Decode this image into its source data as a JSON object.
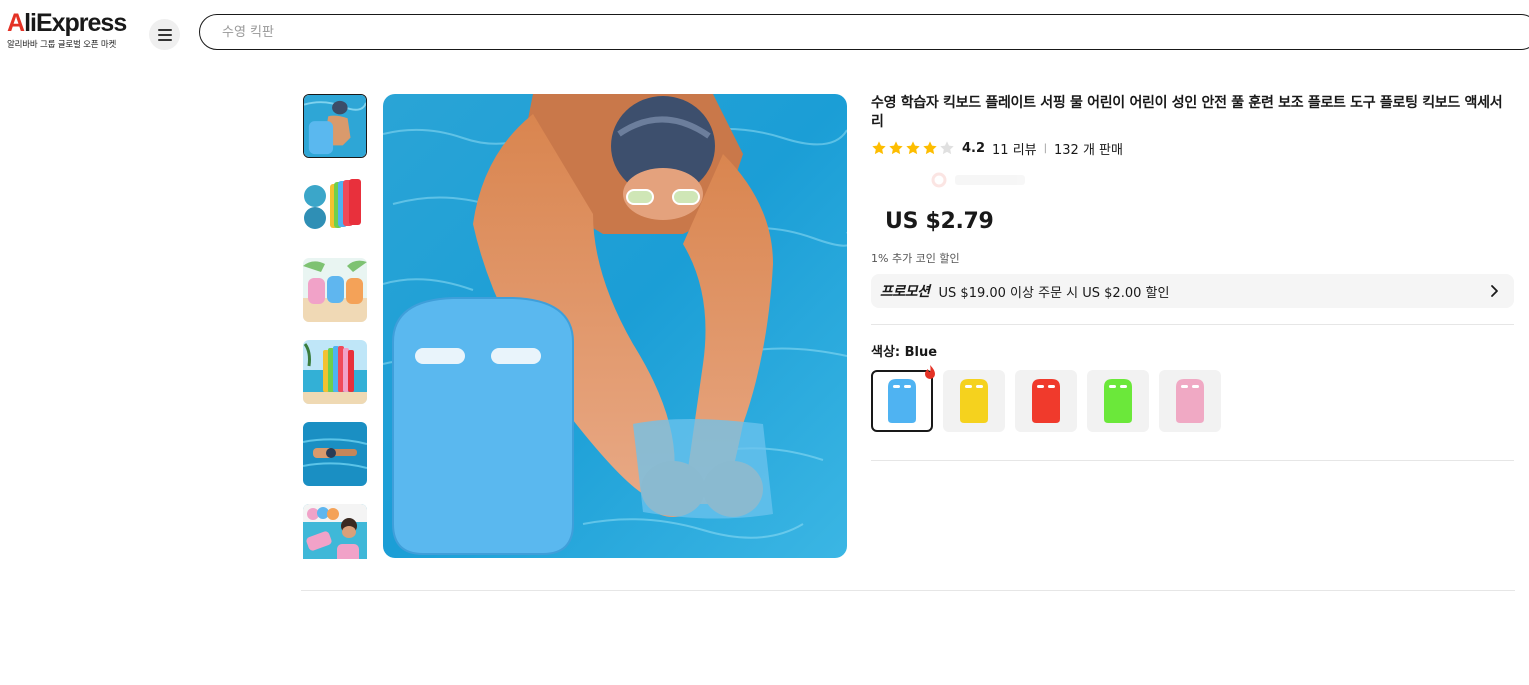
{
  "header": {
    "logo_main": "AliExpress",
    "logo_sub": "알리바바 그룹 글로벌 오픈 마켓",
    "search_placeholder": "수영 킥판"
  },
  "product": {
    "title": "수영 학습자 킥보드 플레이트 서핑 물 어린이 어린이 성인 안전 풀 훈련 보조 플로트 도구 플로팅 킥보드 액세서리",
    "rating": "4.2",
    "rating_stars": 4.2,
    "reviews": "11 리뷰",
    "sold": "132 개 판매",
    "price": "US $2.79",
    "coin_discount": "1% 추가 코인 할인",
    "promo_tag": "프로모션",
    "promo_text": "US $19.00 이상 주문 시 US $2.00 할인",
    "color_label": "색상: Blue",
    "selected_color": "Blue",
    "swatch_colors": [
      "#4fb3f2",
      "#f5d21e",
      "#f03a2c",
      "#6be83a",
      "#f0a9c4"
    ]
  },
  "colors": {
    "brand_red": "#e43225",
    "star_yellow": "#fdbd00",
    "star_empty": "#e0e0e0"
  },
  "icons": [
    "menu-icon",
    "star-icon",
    "chevron-right-icon",
    "hot-badge-icon"
  ]
}
